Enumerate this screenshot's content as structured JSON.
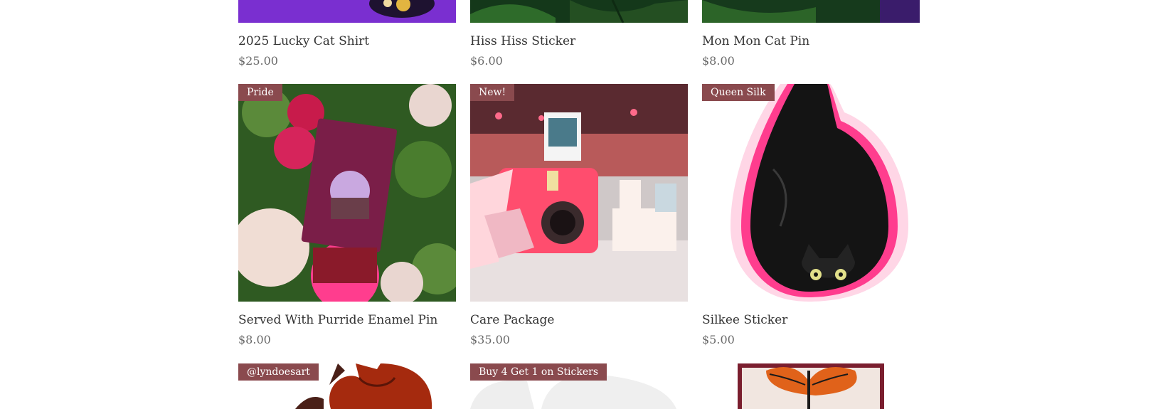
{
  "products_row1": [
    {
      "name": "2025 Lucky Cat Shirt",
      "price": "$25.00"
    },
    {
      "name": "Hiss Hiss Sticker",
      "price": "$6.00"
    },
    {
      "name": "Mon Mon Cat Pin",
      "price": "$8.00"
    }
  ],
  "products_row2": [
    {
      "name": "Served With Purride Enamel Pin",
      "price": "$8.00",
      "ribbon": "Pride"
    },
    {
      "name": "Care Package",
      "price": "$35.00",
      "ribbon": "New!"
    },
    {
      "name": "Silkee Sticker",
      "price": "$5.00",
      "ribbon": "Queen Silk"
    }
  ],
  "products_row3": [
    {
      "ribbon": "@lyndoesart"
    },
    {
      "ribbon": "Buy 4 Get 1 on Stickers"
    },
    {}
  ],
  "colors": {
    "ribbon_bg": "#8a4a4e",
    "shirt_purple": "#7a2fd0",
    "leaf_green": "#1f4d1d",
    "pink_accent": "#ff3d8e"
  }
}
